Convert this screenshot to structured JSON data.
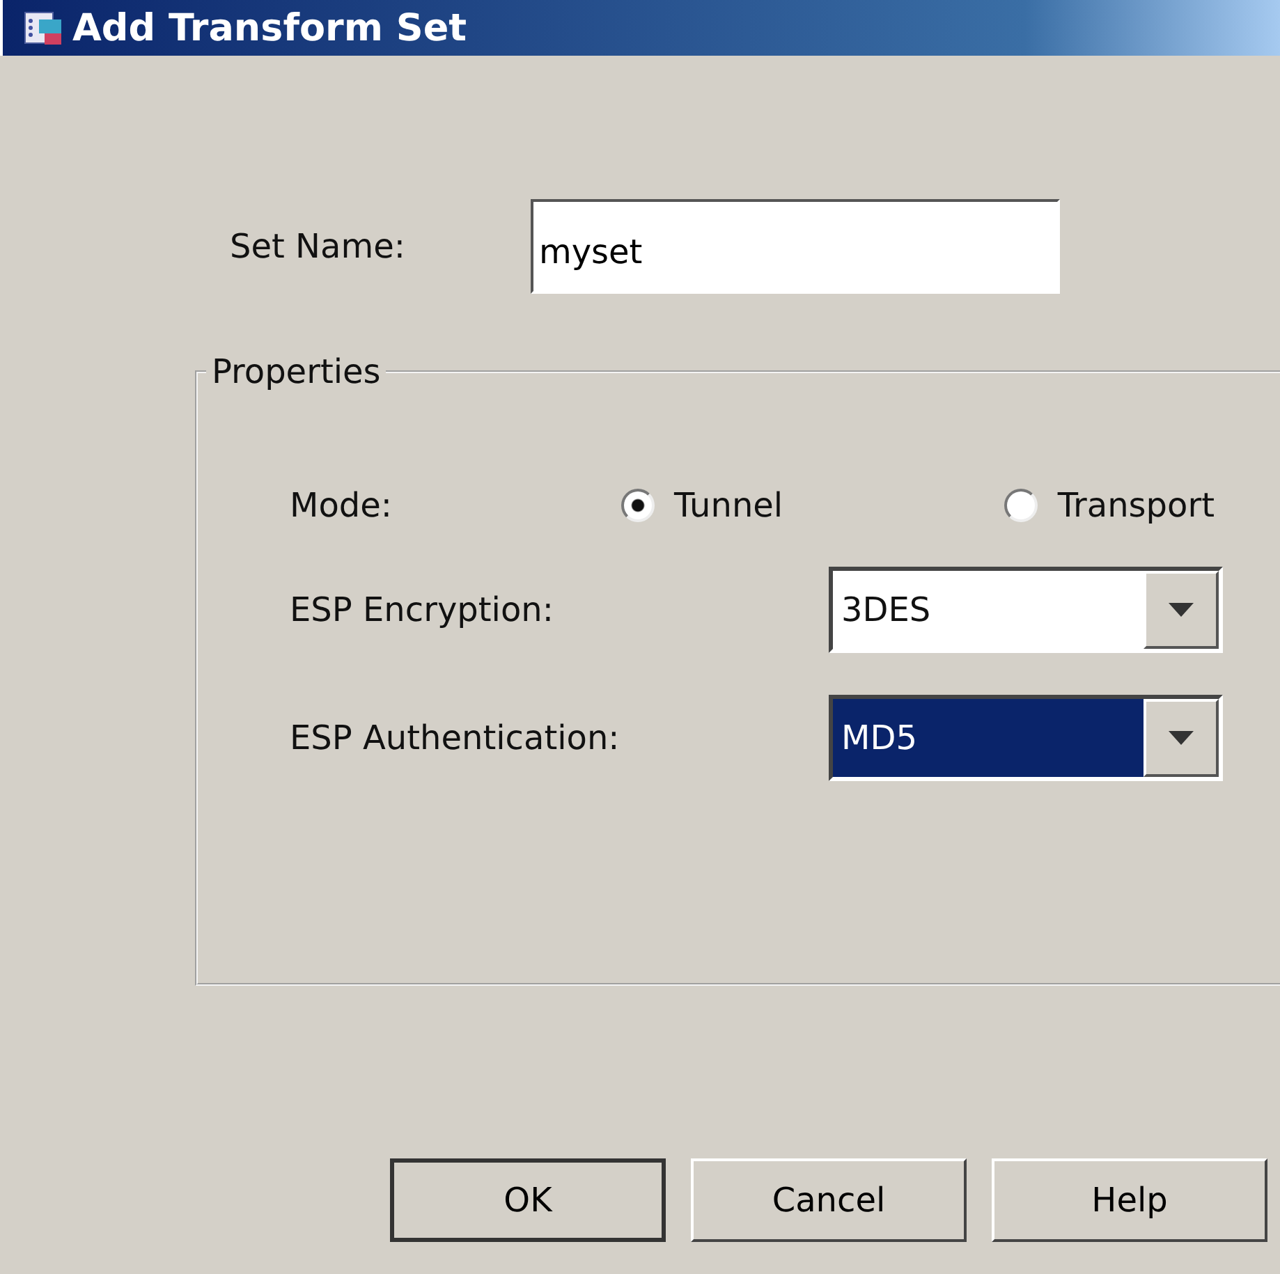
{
  "window": {
    "title": "Add Transform Set"
  },
  "set_name": {
    "label": "Set Name:",
    "value": "myset"
  },
  "properties": {
    "title": "Properties",
    "mode": {
      "label": "Mode:",
      "options": [
        {
          "label": "Tunnel",
          "selected": true
        },
        {
          "label": "Transport",
          "selected": false
        }
      ]
    },
    "dropdowns": [
      {
        "label": "ESP Encryption:",
        "value": "3DES",
        "focused": false
      },
      {
        "label": "ESP Authentication:",
        "value": "MD5",
        "focused": true
      }
    ]
  },
  "buttons": [
    {
      "label": "OK",
      "default": true
    },
    {
      "label": "Cancel",
      "default": false
    },
    {
      "label": "Help",
      "default": false
    }
  ]
}
